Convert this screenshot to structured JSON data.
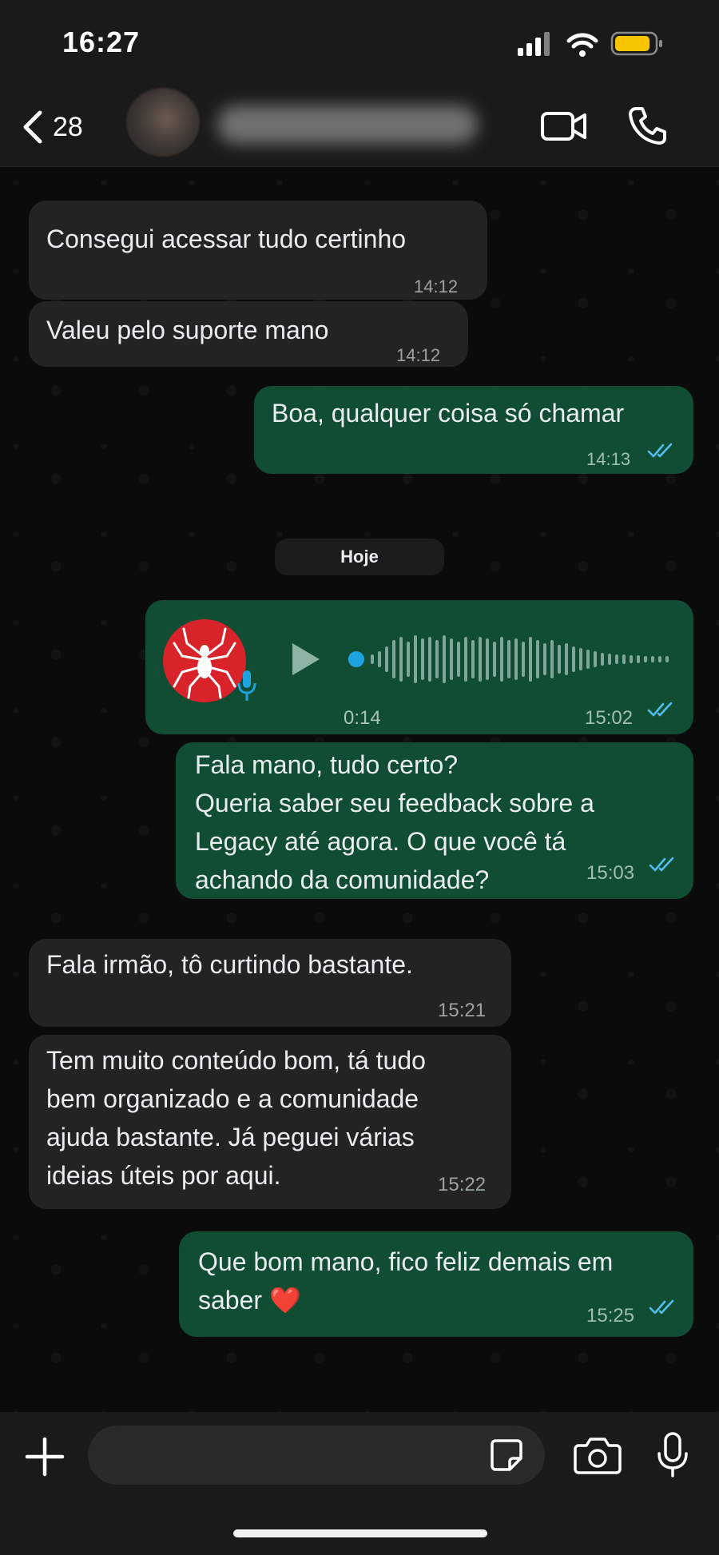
{
  "status_bar": {
    "time": "16:27"
  },
  "header": {
    "back_count": "28"
  },
  "date_separator": "Hoje",
  "messages": [
    {
      "text": "Consegui acessar tudo certinho",
      "time": "14:12"
    },
    {
      "text": "Valeu pelo suporte mano",
      "time": "14:12"
    },
    {
      "text": "Boa, qualquer coisa só chamar",
      "time": "14:13"
    },
    {
      "duration": "0:14",
      "time": "15:02"
    },
    {
      "text": "Fala mano, tudo certo?\nQueria saber seu feedback sobre a\nLegacy até agora. O que você tá\nachando da comunidade?",
      "time": "15:03"
    },
    {
      "text": "Fala irmão, tô curtindo bastante.",
      "time": "15:21"
    },
    {
      "text": "Tem muito conteúdo bom, tá tudo\nbem organizado e a comunidade\najuda bastante. Já peguei várias\nideias úteis por aqui.",
      "time": "15:22"
    },
    {
      "text": "Que bom mano, fico feliz demais em\nsaber ❤️",
      "time": "15:25"
    }
  ],
  "colors": {
    "outgoing_bubble": "#104d33",
    "incoming_bubble": "#232323",
    "read_ticks": "#53bdeb",
    "voice_dot": "#1fa2e0",
    "avatar_red": "#d8232a"
  },
  "icons": [
    "back-chevron-icon",
    "video-call-icon",
    "phone-icon",
    "play-icon",
    "mic-badge-icon",
    "double-check-icon",
    "plus-icon",
    "sticker-icon",
    "camera-icon",
    "microphone-icon",
    "signal-icon",
    "wifi-icon",
    "battery-icon"
  ]
}
